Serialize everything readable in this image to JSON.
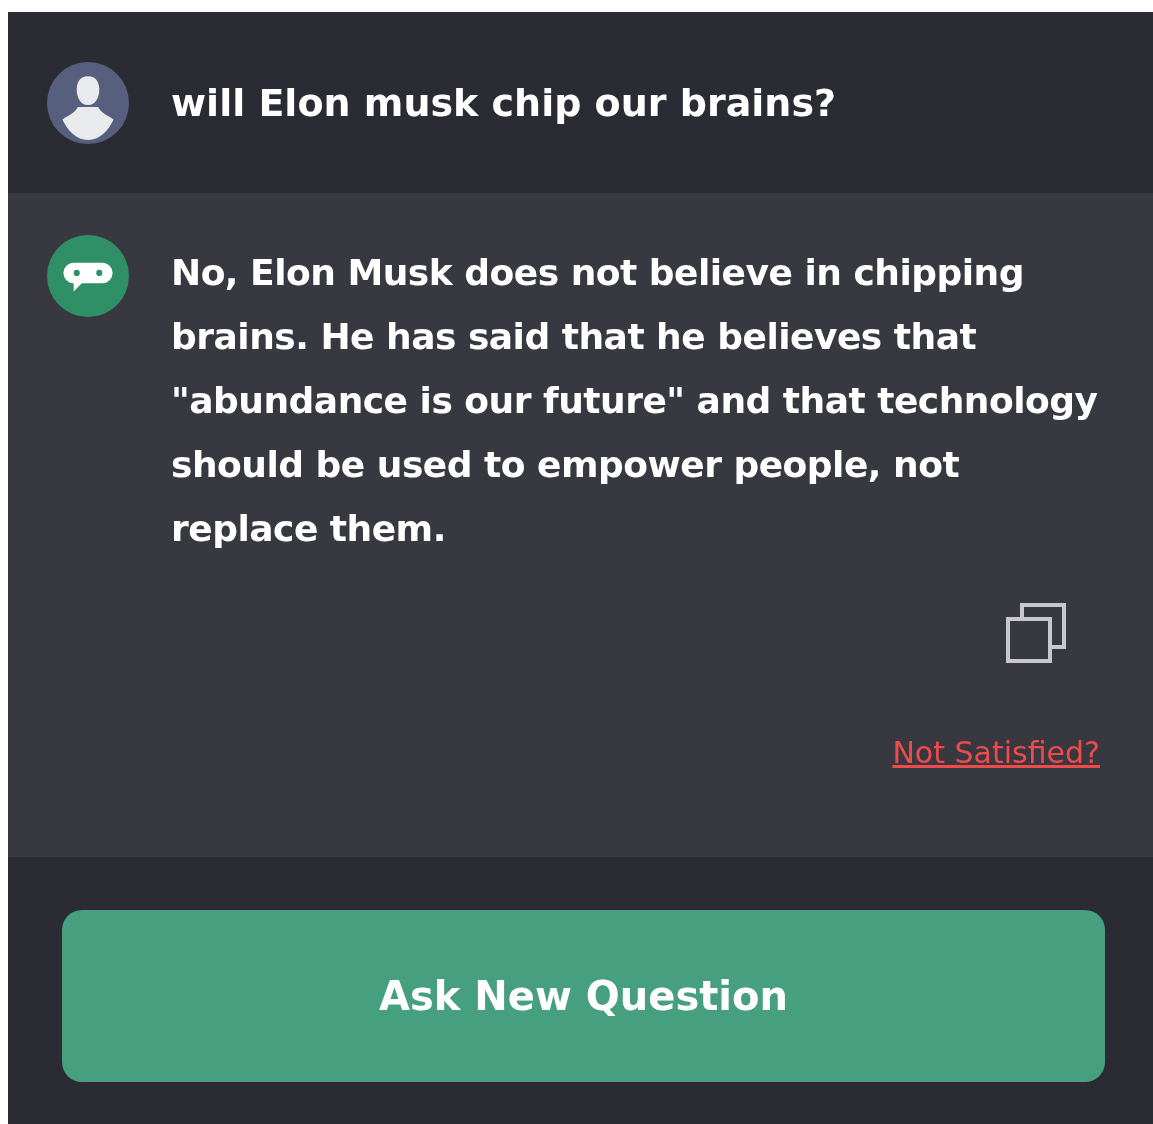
{
  "question": {
    "text": "will Elon musk chip our brains?"
  },
  "answer": {
    "text": "No, Elon Musk does not believe in chipping brains. He has said that he believes that \"abundance is our future\" and that technology should be used to empower people, not replace them."
  },
  "feedback_link": "Not Satisfied?",
  "primary_button": "Ask New Question"
}
